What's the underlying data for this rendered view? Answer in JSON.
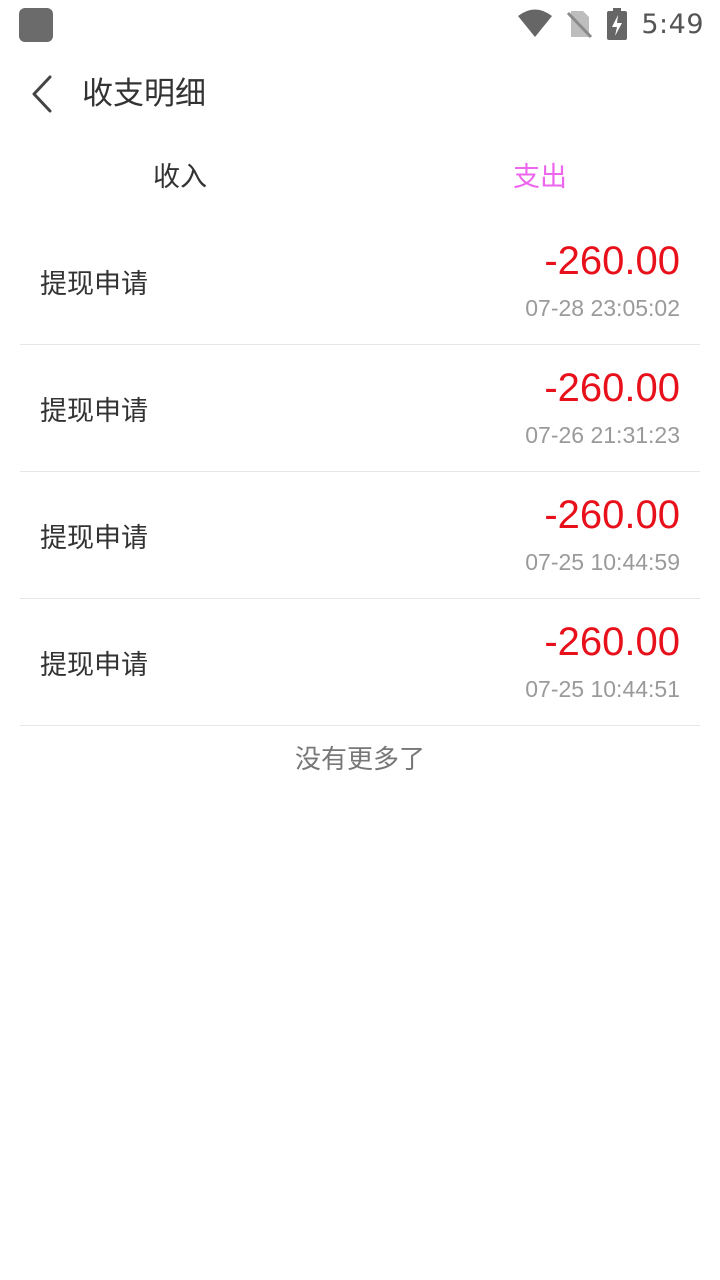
{
  "status_bar": {
    "time": "5:49",
    "icons": [
      "app-icon",
      "wifi-icon",
      "no-sim-icon",
      "battery-charging-icon"
    ]
  },
  "header": {
    "back_icon": "chevron-left-icon",
    "title": "收支明细"
  },
  "tabs": [
    {
      "label": "收入",
      "active": false
    },
    {
      "label": "支出",
      "active": true
    }
  ],
  "colors": {
    "accent": "#ee66ee",
    "amount": "#e8101a",
    "timestamp": "#9a9a9a"
  },
  "records": [
    {
      "label": "提现申请",
      "amount": "-260.00",
      "time": "07-28 23:05:02"
    },
    {
      "label": "提现申请",
      "amount": "-260.00",
      "time": "07-26 21:31:23"
    },
    {
      "label": "提现申请",
      "amount": "-260.00",
      "time": "07-25 10:44:59"
    },
    {
      "label": "提现申请",
      "amount": "-260.00",
      "time": "07-25 10:44:51"
    }
  ],
  "footer": {
    "no_more_text": "没有更多了"
  }
}
